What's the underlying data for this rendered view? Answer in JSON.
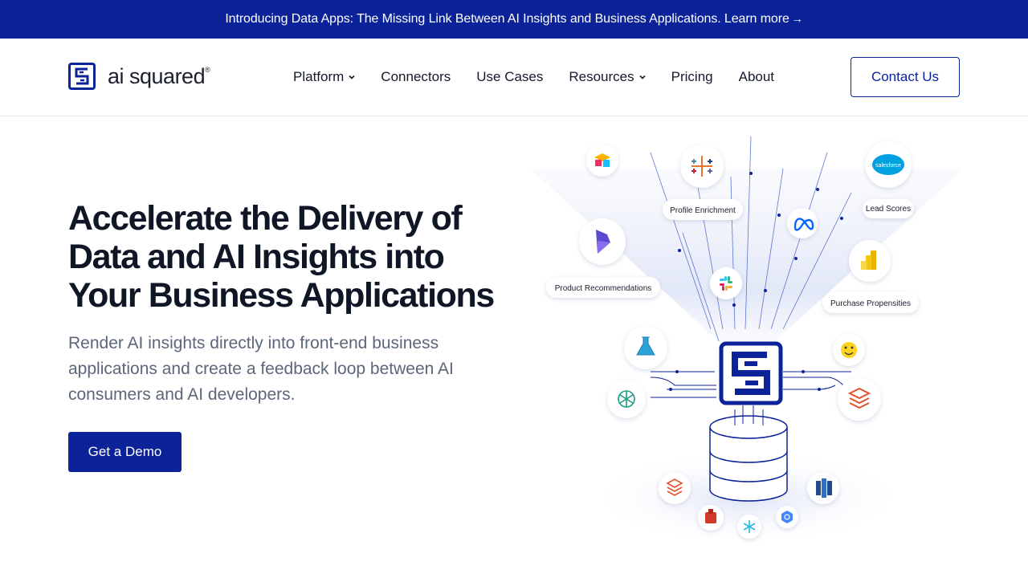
{
  "announcement": {
    "text": "Introducing Data Apps: The Missing Link Between AI Insights and Business Applications. Learn more",
    "arrow": "→"
  },
  "brand": {
    "name": "ai squared",
    "registered": "®",
    "color": "#0b2299"
  },
  "nav": {
    "items": [
      {
        "label": "Platform",
        "has_dropdown": true
      },
      {
        "label": "Connectors",
        "has_dropdown": false
      },
      {
        "label": "Use Cases",
        "has_dropdown": false
      },
      {
        "label": "Resources",
        "has_dropdown": true
      },
      {
        "label": "Pricing",
        "has_dropdown": false
      },
      {
        "label": "About",
        "has_dropdown": false
      }
    ],
    "contact_label": "Contact Us"
  },
  "hero": {
    "title": "Accelerate the Delivery of Data and AI Insights into Your Business Applications",
    "subtitle": "Render AI insights directly into front-end business applications and create a feedback loop between AI consumers and AI developers.",
    "cta_label": "Get a Demo"
  },
  "illustration": {
    "labels": {
      "profile_enrichment": "Profile Enrichment",
      "lead_scores": "Lead Scores",
      "product_recommendations": "Product Recommendations",
      "purchase_propensities": "Purchase Propensities",
      "salesforce": "salesforce"
    },
    "icons": [
      "airtable-icon",
      "tableau-icon",
      "salesforce-icon",
      "dynamics-icon",
      "meta-icon",
      "slack-icon",
      "powerbi-icon",
      "azure-ml-icon",
      "huggingface-icon",
      "openai-icon",
      "databricks-icon",
      "redshift-icon",
      "snowflake-icon",
      "bigquery-icon",
      "aws-icon",
      "ai-squared-hub-icon",
      "database-icon"
    ]
  }
}
